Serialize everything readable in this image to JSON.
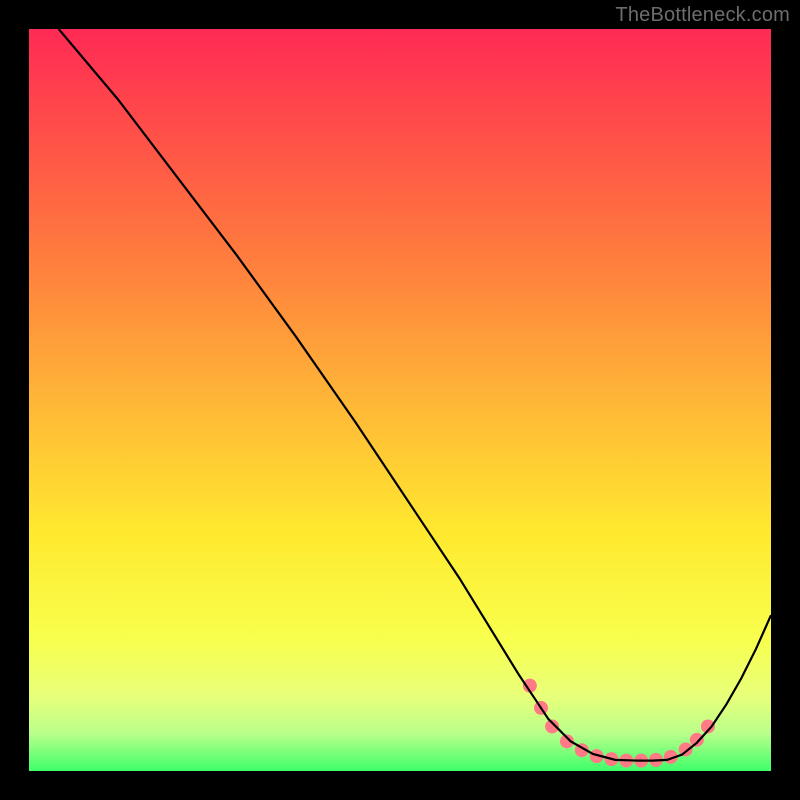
{
  "watermark": "TheBottleneck.com",
  "chart_data": {
    "type": "line",
    "title": "",
    "xlabel": "",
    "ylabel": "",
    "xlim": [
      0,
      100
    ],
    "ylim": [
      0,
      100
    ],
    "grid": false,
    "legend": false,
    "series": [
      {
        "name": "curve",
        "stroke": "#000000",
        "x": [
          4,
          12,
          20,
          28,
          36,
          44,
          52,
          58,
          62,
          66,
          68,
          70,
          73,
          76,
          79,
          82,
          84,
          86,
          88,
          90,
          92,
          94,
          96,
          98,
          100
        ],
        "y": [
          100,
          90.5,
          80,
          69.5,
          58.5,
          47,
          35,
          26,
          19.5,
          13,
          10,
          7,
          4,
          2.3,
          1.5,
          1.4,
          1.4,
          1.5,
          2.2,
          3.8,
          6,
          9,
          12.5,
          16.5,
          21
        ]
      }
    ],
    "markers": [
      {
        "name": "pink-dots",
        "color": "#ff7a85",
        "radius_px": 7,
        "points": [
          {
            "x": 67.5,
            "y": 11.5
          },
          {
            "x": 69.0,
            "y": 8.5
          },
          {
            "x": 70.5,
            "y": 6.0
          },
          {
            "x": 72.5,
            "y": 4.0
          },
          {
            "x": 74.5,
            "y": 2.8
          },
          {
            "x": 76.5,
            "y": 2.0
          },
          {
            "x": 78.5,
            "y": 1.6
          },
          {
            "x": 80.5,
            "y": 1.4
          },
          {
            "x": 82.5,
            "y": 1.4
          },
          {
            "x": 84.5,
            "y": 1.5
          },
          {
            "x": 86.5,
            "y": 1.9
          },
          {
            "x": 88.5,
            "y": 2.9
          },
          {
            "x": 90.0,
            "y": 4.2
          },
          {
            "x": 91.5,
            "y": 6.0
          }
        ]
      }
    ]
  }
}
